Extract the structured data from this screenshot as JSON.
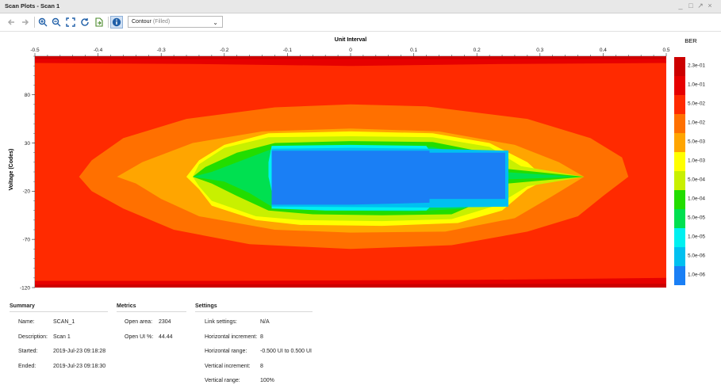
{
  "window": {
    "title": "Scan Plots - Scan 1"
  },
  "toolbar": {
    "plot_type_value": "Contour",
    "plot_type_suffix": "(Filled)"
  },
  "icons": [
    "back-icon",
    "forward-icon",
    "zoom-in-icon",
    "zoom-out-icon",
    "fit-icon",
    "refresh-icon",
    "export-icon",
    "info-icon",
    "chevron-down-icon"
  ],
  "chart_data": {
    "type": "heatmap",
    "title": "Unit Interval",
    "xlabel": "Unit Interval",
    "ylabel": "Voltage (Codes)",
    "xlim": [
      -0.5,
      0.5
    ],
    "ylim": [
      -120,
      120
    ],
    "x_ticks": [
      "-0.5",
      "-0.4",
      "-0.3",
      "-0.2",
      "-0.1",
      "0",
      "0.1",
      "0.2",
      "0.3",
      "0.4",
      "0.5"
    ],
    "y_ticks": [
      "80",
      "30",
      "-20",
      "-70",
      "-120"
    ],
    "y_tick_values": [
      80,
      30,
      -20,
      -70,
      -120
    ],
    "legend_title": "BER",
    "legend_levels": [
      "2.3e-01",
      "1.0e-01",
      "5.0e-02",
      "1.0e-02",
      "5.0e-03",
      "1.0e-03",
      "5.0e-04",
      "1.0e-04",
      "5.0e-05",
      "1.0e-05",
      "5.0e-06",
      "1.0e-06"
    ],
    "legend_colors": [
      "#cc0000",
      "#e60000",
      "#ff2a00",
      "#ff7000",
      "#ffa500",
      "#ffff00",
      "#c8f000",
      "#22dd00",
      "#00e050",
      "#00f0f0",
      "#00c0f0",
      "#1a7ff5"
    ],
    "contours": [
      {
        "level": "5.0e-02",
        "halfwidth": [
          0.5,
          0.5,
          0.5,
          0.5,
          0.5,
          0.5,
          0.5,
          0.5,
          0.5,
          0.5
        ]
      },
      {
        "level": "1.0e-02",
        "x_extent": 0.44,
        "y_extent": 88,
        "at_y": [
          [
            -120,
            0.0
          ],
          [
            -108,
            0.36
          ],
          [
            -90,
            0.4
          ],
          [
            -60,
            0.42
          ],
          [
            0,
            0.44
          ],
          [
            40,
            0.42
          ],
          [
            70,
            0.38
          ],
          [
            88,
            0.0
          ]
        ]
      },
      {
        "level": "5.0e-03",
        "x_extent": 0.37,
        "y_extent": 62
      },
      {
        "level": "1.0e-03",
        "x_extent": 0.37,
        "y_extent": 55
      },
      {
        "level": "5.0e-04",
        "x_extent": 0.375,
        "y_extent": 50
      },
      {
        "level": "1.0e-04",
        "x_extent": 0.37,
        "y_extent": 42
      },
      {
        "level": "5.0e-05",
        "x_extent": 0.32,
        "y_extent": 36
      },
      {
        "level": "1.0e-05",
        "x_extent": 0.18,
        "y_extent": 32
      },
      {
        "level": "1.0e-06",
        "x_range": [
          -0.125,
          0.25
        ],
        "y_range": [
          -49,
          34
        ]
      }
    ]
  },
  "summary": {
    "title": "Summary",
    "name_label": "Name:",
    "name_value": "SCAN_1",
    "desc_label": "Description:",
    "desc_value": "Scan 1",
    "started_label": "Started:",
    "started_value": "2019-Jul-23 09:18:28",
    "ended_label": "Ended:",
    "ended_value": "2019-Jul-23 09:18:30"
  },
  "metrics": {
    "title": "Metrics",
    "open_area_label": "Open area:",
    "open_area_value": "2304",
    "open_ui_label": "Open UI %:",
    "open_ui_value": "44.44"
  },
  "settings": {
    "title": "Settings",
    "link_label": "Link settings:",
    "link_value": "N/A",
    "hinc_label": "Horizontal increment:",
    "hinc_value": "8",
    "hrange_label": "Horizontal range:",
    "hrange_value": "-0.500 UI to 0.500 UI",
    "vinc_label": "Vertical increment:",
    "vinc_value": "8",
    "vrange_label": "Vertical range:",
    "vrange_value": "100%"
  }
}
